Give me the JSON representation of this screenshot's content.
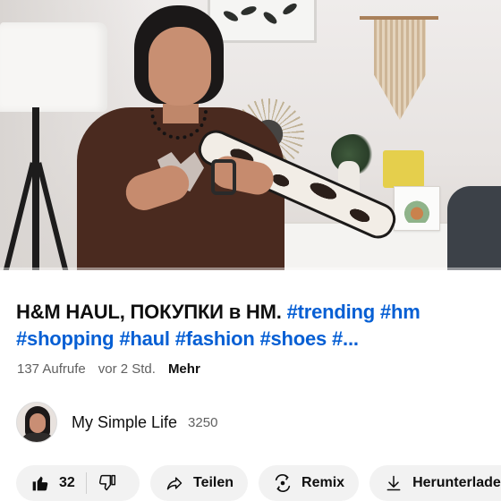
{
  "video": {
    "progress_fraction": 0.0
  },
  "title": {
    "plain": "H&M HAUL, ПОКУПКИ в НМ. ",
    "hashtags": "#trending #hm #shopping #haul #fashion #shoes #..."
  },
  "meta": {
    "views": "137 Aufrufe",
    "age": "vor 2 Std.",
    "more_label": "Mehr"
  },
  "channel": {
    "name": "My Simple Life",
    "subscribers": "3250"
  },
  "actions": {
    "like_count": "32",
    "share_label": "Teilen",
    "remix_label": "Remix",
    "download_label": "Herunterladen"
  },
  "icons": {
    "like": "thumbs-up-icon",
    "dislike": "thumbs-down-icon",
    "share": "share-arrow-icon",
    "remix": "remix-icon",
    "download": "download-icon"
  },
  "colors": {
    "hashtag": "#065fd4",
    "progress": "#ff0033",
    "pill_bg": "#f2f2f2",
    "secondary_text": "#606060"
  }
}
